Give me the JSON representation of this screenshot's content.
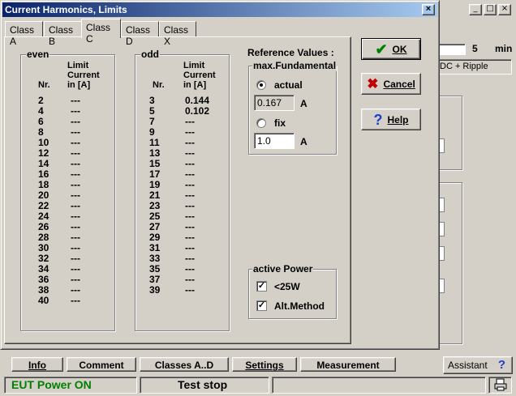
{
  "background": {
    "time_value": "5",
    "time_unit": "min",
    "mode_text": "DC + Ripple"
  },
  "dialog": {
    "title": "Current Harmonics, Limits",
    "close_glyph": "×",
    "tabs": [
      "Class A",
      "Class B",
      "Class C",
      "Class D",
      "Class X"
    ],
    "active_tab": "Class C"
  },
  "even": {
    "group_title": "even",
    "nr_header": "Nr.",
    "limit_header_lines": [
      "Limit",
      "Current",
      "in [A]"
    ],
    "rows": [
      {
        "nr": "2",
        "limit": "---"
      },
      {
        "nr": "4",
        "limit": "---"
      },
      {
        "nr": "6",
        "limit": "---"
      },
      {
        "nr": "8",
        "limit": "---"
      },
      {
        "nr": "10",
        "limit": "---"
      },
      {
        "nr": "12",
        "limit": "---"
      },
      {
        "nr": "14",
        "limit": "---"
      },
      {
        "nr": "16",
        "limit": "---"
      },
      {
        "nr": "18",
        "limit": "---"
      },
      {
        "nr": "20",
        "limit": "---"
      },
      {
        "nr": "22",
        "limit": "---"
      },
      {
        "nr": "24",
        "limit": "---"
      },
      {
        "nr": "26",
        "limit": "---"
      },
      {
        "nr": "28",
        "limit": "---"
      },
      {
        "nr": "30",
        "limit": "---"
      },
      {
        "nr": "32",
        "limit": "---"
      },
      {
        "nr": "34",
        "limit": "---"
      },
      {
        "nr": "36",
        "limit": "---"
      },
      {
        "nr": "38",
        "limit": "---"
      },
      {
        "nr": "40",
        "limit": "---"
      }
    ]
  },
  "odd": {
    "group_title": "odd",
    "nr_header": "Nr.",
    "limit_header_lines": [
      "Limit",
      "Current",
      "in [A]"
    ],
    "rows": [
      {
        "nr": "3",
        "limit": "0.144"
      },
      {
        "nr": "5",
        "limit": "0.102"
      },
      {
        "nr": "7",
        "limit": "---"
      },
      {
        "nr": "9",
        "limit": "---"
      },
      {
        "nr": "11",
        "limit": "---"
      },
      {
        "nr": "13",
        "limit": "---"
      },
      {
        "nr": "15",
        "limit": "---"
      },
      {
        "nr": "17",
        "limit": "---"
      },
      {
        "nr": "19",
        "limit": "---"
      },
      {
        "nr": "21",
        "limit": "---"
      },
      {
        "nr": "23",
        "limit": "---"
      },
      {
        "nr": "25",
        "limit": "---"
      },
      {
        "nr": "27",
        "limit": "---"
      },
      {
        "nr": "29",
        "limit": "---"
      },
      {
        "nr": "31",
        "limit": "---"
      },
      {
        "nr": "33",
        "limit": "---"
      },
      {
        "nr": "35",
        "limit": "---"
      },
      {
        "nr": "37",
        "limit": "---"
      },
      {
        "nr": "39",
        "limit": "---"
      }
    ]
  },
  "reference": {
    "title": "Reference Values :",
    "group_title": "max.Fundamental",
    "actual_label": "actual",
    "actual_value": "0.167",
    "actual_unit": "A",
    "actual_checked": true,
    "fix_label": "fix",
    "fix_value": "1.0",
    "fix_unit": "A",
    "fix_checked": false
  },
  "active_power": {
    "group_title": "active Power",
    "lt25w_label": "<25W",
    "lt25w_checked": true,
    "alt_method_label": "Alt.Method",
    "alt_method_checked": true
  },
  "buttons": {
    "ok_label": "OK",
    "cancel_label": "Cancel",
    "help_label": "Help"
  },
  "bottom_tabs": [
    "Info",
    "Comment",
    "Classes A..D",
    "Settings",
    "Measurement"
  ],
  "assistant_label": "Assistant",
  "status": {
    "power": "EUT Power ON",
    "power_color": "#008000",
    "test": "Test stop"
  },
  "colors": {
    "ok_check": "#008000",
    "cancel_x": "#c00000",
    "help_q": "#1c3fd0"
  }
}
